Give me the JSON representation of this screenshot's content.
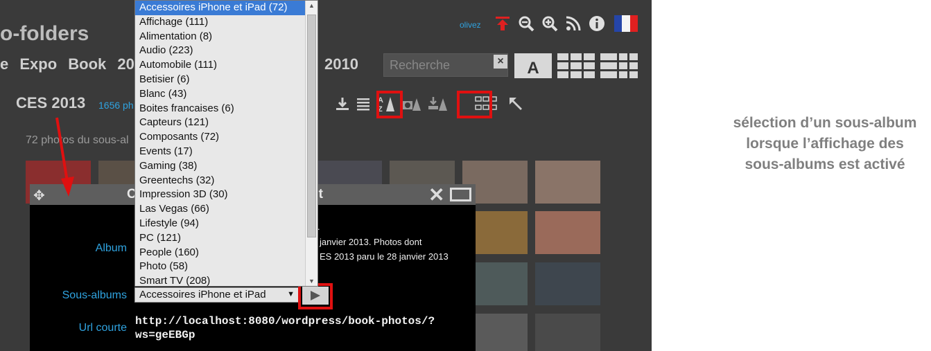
{
  "site": {
    "title": "o-folders"
  },
  "menu": {
    "items": [
      "e",
      "Expo",
      "Book",
      "20"
    ],
    "year": "2010"
  },
  "user": {
    "name": "olivez"
  },
  "header_icons": [
    "upload-icon",
    "zoom-out-icon",
    "zoom-in-icon",
    "rss-icon",
    "info-icon",
    "flag-france-icon"
  ],
  "search": {
    "placeholder": "Recherche",
    "clear": "×"
  },
  "album": {
    "title": "CES 2013",
    "count": "1656 ph",
    "subtitle": "72 photos du sous-al"
  },
  "toolbar": {
    "sort_label": "A Z"
  },
  "dialog": {
    "title_start": "O",
    "title_end": "nt",
    "album_label": "Album",
    "desc_line1": ".",
    "desc_line2": "janvier 2013. Photos dont",
    "desc_line3": "ES 2013 paru le 28 janvier 2013",
    "subalbums_label": "Sous-albums",
    "url_label": "Url courte",
    "url_value": "http://localhost:8080/wordpress/book-photos/?ws=geEBGp",
    "select_value": "Accessoires iPhone et iPad"
  },
  "dropdown": {
    "options": [
      "Accessoires iPhone et iPad (72)",
      "Affichage (111)",
      "Alimentation (8)",
      "Audio (223)",
      "Automobile (111)",
      "Betisier (6)",
      "Blanc (43)",
      "Boites francaises (6)",
      "Capteurs (121)",
      "Composants (72)",
      "Events (17)",
      "Gaming (38)",
      "Greentechs (32)",
      "Impression 3D (30)",
      "Las Vegas (66)",
      "Lifestyle (94)",
      "PC (121)",
      "People (160)",
      "Photo (58)",
      "Smart TV (208)"
    ],
    "selected_index": 0
  },
  "caption": {
    "text": "sélection d’un sous-album lorsque l’affichage des sous-albums est activé"
  },
  "colors": {
    "accent": "#2fa3e0",
    "highlight": "#e01010",
    "app_bg": "#3a3a3a"
  }
}
